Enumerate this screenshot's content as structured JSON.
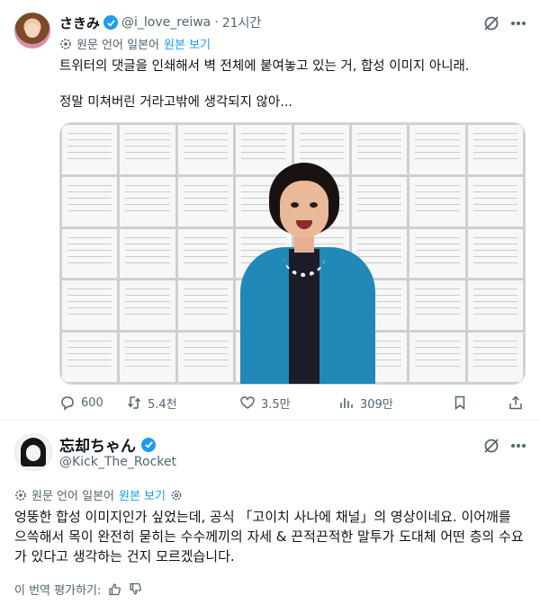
{
  "post1": {
    "display_name": "さきみ",
    "handle": "@i_love_reiwa",
    "separator": "·",
    "time": "21시간",
    "translate_prefix": "원문 언어 일본어",
    "translate_link": "원본 보기",
    "text_line1": "트위터의 댓글을 인쇄해서 벽 전체에 붙여놓고 있는 거, 합성 이미지 아니래.",
    "text_line2": "정말 미쳐버린 거라고밖에 생각되지 않아...",
    "stats": {
      "replies": "600",
      "reposts": "5.4천",
      "likes": "3.5만",
      "views": "309만"
    }
  },
  "post2": {
    "display_name": "忘却ちゃん",
    "handle": "@Kick_The_Rocket",
    "translate_prefix": "원문 언어 일본어",
    "translate_link": "원본 보기",
    "text": "엉뚱한 합성 이미지인가 싶었는데, 공식 「고이치 사나에 채널」의 영상이네요. 이어깨를 으쓱해서 목이 완전히 묻히는 수수께끼의 자세 & 끈적끈적한 말투가 도대체 어떤 층의 수요가 있다고 생각하는 건지 모르겠습니다.",
    "rate_label": "이 번역 평가하기:"
  },
  "colors": {
    "accent": "#1d9bf0",
    "secondary_text": "#536471",
    "primary_text": "#0f1419"
  }
}
